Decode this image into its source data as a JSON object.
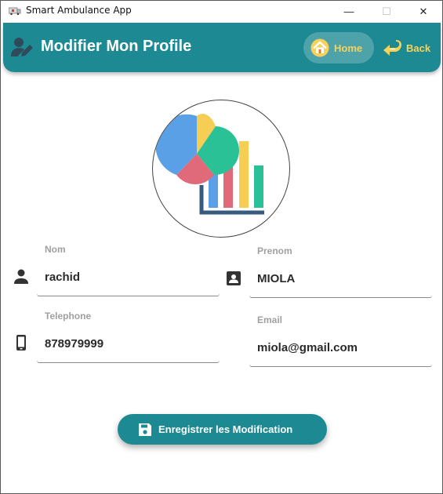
{
  "window": {
    "title": "Smart Ambulance App",
    "minimize_glyph": "—",
    "maximize_glyph": "☐",
    "close_glyph": "✕"
  },
  "header": {
    "title": "Modifier Mon Profile",
    "icon": "user-edit-icon",
    "home_label": "Home",
    "home_icon": "home-icon",
    "back_label": "Back",
    "back_icon": "back-arrow-icon"
  },
  "avatar": {
    "icon": "analytics-chart-icon"
  },
  "form": {
    "nom": {
      "label": "Nom",
      "value": "rachid",
      "icon": "person-icon"
    },
    "prenom": {
      "label": "Prenom",
      "value": "MIOLA",
      "icon": "contact-card-icon"
    },
    "telephone": {
      "label": "Telephone",
      "value": "878979999",
      "icon": "phone-icon"
    },
    "email": {
      "label": "Email",
      "value": "miola@gmail.com"
    }
  },
  "save_button": {
    "label": "Enregistrer les Modification",
    "icon": "floppy-disk-icon"
  },
  "colors": {
    "primary": "#1d8a93",
    "accent": "#f6d25a"
  }
}
